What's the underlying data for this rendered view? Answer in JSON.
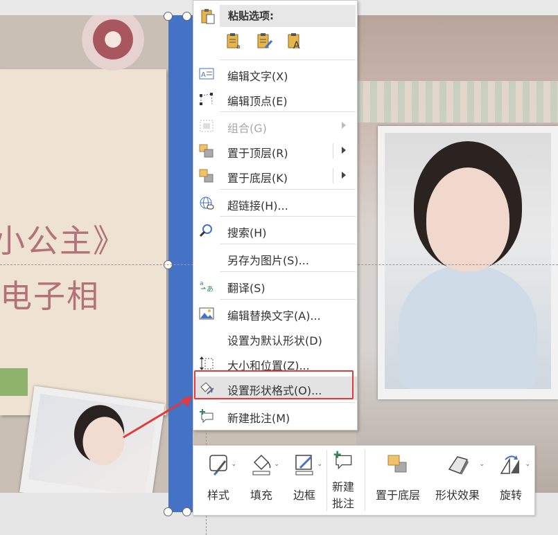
{
  "menu": {
    "paste_options": "粘贴选项:",
    "items": [
      {
        "label": "编辑文字(X)",
        "icon": "edit-text-icon"
      },
      {
        "label": "编辑顶点(E)",
        "icon": "edit-points-icon"
      },
      {
        "label": "组合(G)",
        "icon": "group-icon",
        "disabled": true
      },
      {
        "label": "置于顶层(R)",
        "icon": "bring-to-front-icon"
      },
      {
        "label": "置于底层(K)",
        "icon": "send-to-back-icon"
      },
      {
        "label": "超链接(H)...",
        "icon": "hyperlink-icon"
      },
      {
        "label": "搜索(H)",
        "icon": "search-icon"
      },
      {
        "label": "另存为图片(S)...",
        "icon": ""
      },
      {
        "label": "翻译(S)",
        "icon": "translate-icon"
      },
      {
        "label": "编辑替换文字(A)...",
        "icon": "alt-text-icon"
      },
      {
        "label": "设置为默认形状(D)",
        "icon": ""
      },
      {
        "label": "大小和位置(Z)...",
        "icon": "size-position-icon"
      },
      {
        "label": "设置形状格式(O)...",
        "icon": "format-shape-icon"
      },
      {
        "label": "新建批注(M)",
        "icon": "new-comment-icon"
      }
    ]
  },
  "toolbar": {
    "style": "样式",
    "fill": "填充",
    "border": "边框",
    "new_comment_1": "新建",
    "new_comment_2": "批注",
    "send_back": "置于底层",
    "shape_effects": "形状效果",
    "rotate": "旋转"
  },
  "slide": {
    "title_line1": "小公主》",
    "title_line2": "电子相"
  },
  "colors": {
    "selection_fill": "#4472c4",
    "highlight_box": "#e03a3a",
    "title_text": "#b3727a"
  }
}
